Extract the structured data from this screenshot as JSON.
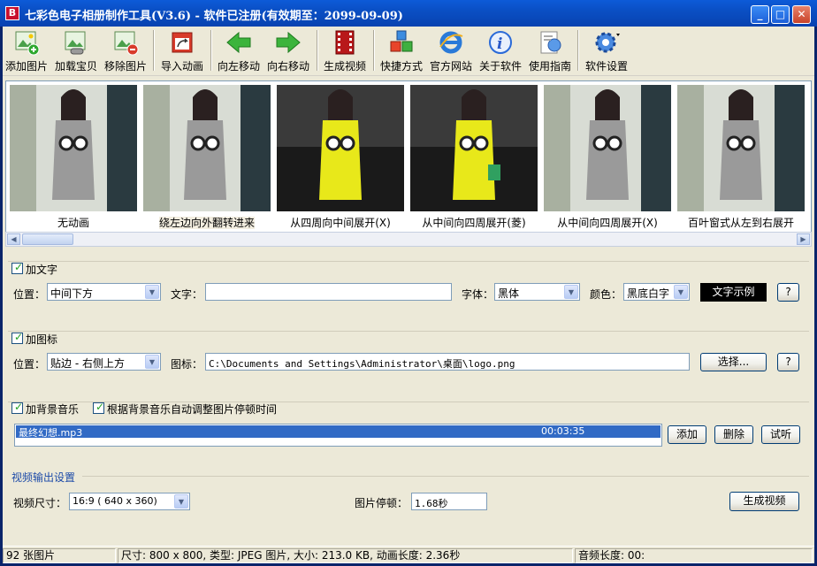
{
  "window": {
    "title": "七彩色电子相册制作工具(V3.6) - 软件已注册(有效期至：2099-09-09)",
    "app_icon_letter": "B"
  },
  "toolbar": [
    {
      "label": "添加图片",
      "icon": "add-image-icon"
    },
    {
      "label": "加载宝贝",
      "icon": "load-product-icon"
    },
    {
      "label": "移除图片",
      "icon": "remove-image-icon"
    },
    {
      "label": "导入动画",
      "icon": "import-animation-icon"
    },
    {
      "label": "向左移动",
      "icon": "arrow-left-icon"
    },
    {
      "label": "向右移动",
      "icon": "arrow-right-icon"
    },
    {
      "label": "生成视频",
      "icon": "film-icon"
    },
    {
      "label": "快捷方式",
      "icon": "shortcut-cubes-icon"
    },
    {
      "label": "官方网站",
      "icon": "ie-icon"
    },
    {
      "label": "关于软件",
      "icon": "info-icon"
    },
    {
      "label": "使用指南",
      "icon": "guide-icon"
    },
    {
      "label": "软件设置",
      "icon": "gear-icon"
    }
  ],
  "thumbnails": [
    {
      "caption": "无动画",
      "dress": "gray"
    },
    {
      "caption": "绕左边向外翻转进来",
      "dress": "gray"
    },
    {
      "caption": "从四周向中间展开(X)",
      "dress": "yellow"
    },
    {
      "caption": "从中间向四周展开(菱)",
      "dress": "yellow"
    },
    {
      "caption": "从中间向四周展开(X)",
      "dress": "gray"
    },
    {
      "caption": "百叶窗式从左到右展开",
      "dress": "gray"
    }
  ],
  "text_group": {
    "checkbox_label": "加文字",
    "position_label": "位置：",
    "position_value": "中间下方",
    "text_label": "文字：",
    "text_value": "",
    "font_label": "字体：",
    "font_value": "黑体",
    "color_label": "颜色：",
    "color_value": "黑底白字",
    "sample_button": "文字示例",
    "help_button": "?"
  },
  "icon_group": {
    "checkbox_label": "加图标",
    "position_label": "位置：",
    "position_value": "贴边  - 右侧上方",
    "icon_label": "图标：",
    "icon_path": "C:\\Documents and Settings\\Administrator\\桌面\\logo.png",
    "choose_button": "选择...",
    "help_button": "?"
  },
  "music_group": {
    "checkbox_label": "加背景音乐",
    "auto_adjust_label": "根据背景音乐自动调整图片停顿时间",
    "tracks": [
      {
        "name": "最终幻想.mp3",
        "duration": "00:03:35"
      }
    ],
    "add_button": "添加",
    "delete_button": "删除",
    "preview_button": "试听"
  },
  "video_group": {
    "title": "视频输出设置",
    "size_label": "视频尺寸：",
    "size_value": "16:9 ( 640 x  360)",
    "pause_label": "图片停顿：",
    "pause_value": "1.68秒",
    "generate_button": "生成视频"
  },
  "status": {
    "count": "92 张图片",
    "info": "尺寸: 800 x 800, 类型: JPEG 图片, 大小: 213.0 KB, 动画长度: 2.36秒",
    "audio": "音频长度: 00:"
  },
  "colors": {
    "title_blue": "#0a4fc4",
    "selection": "#316ac5",
    "yellow_dress": "#e8e81a",
    "gray_dress": "#9a9a9a"
  }
}
